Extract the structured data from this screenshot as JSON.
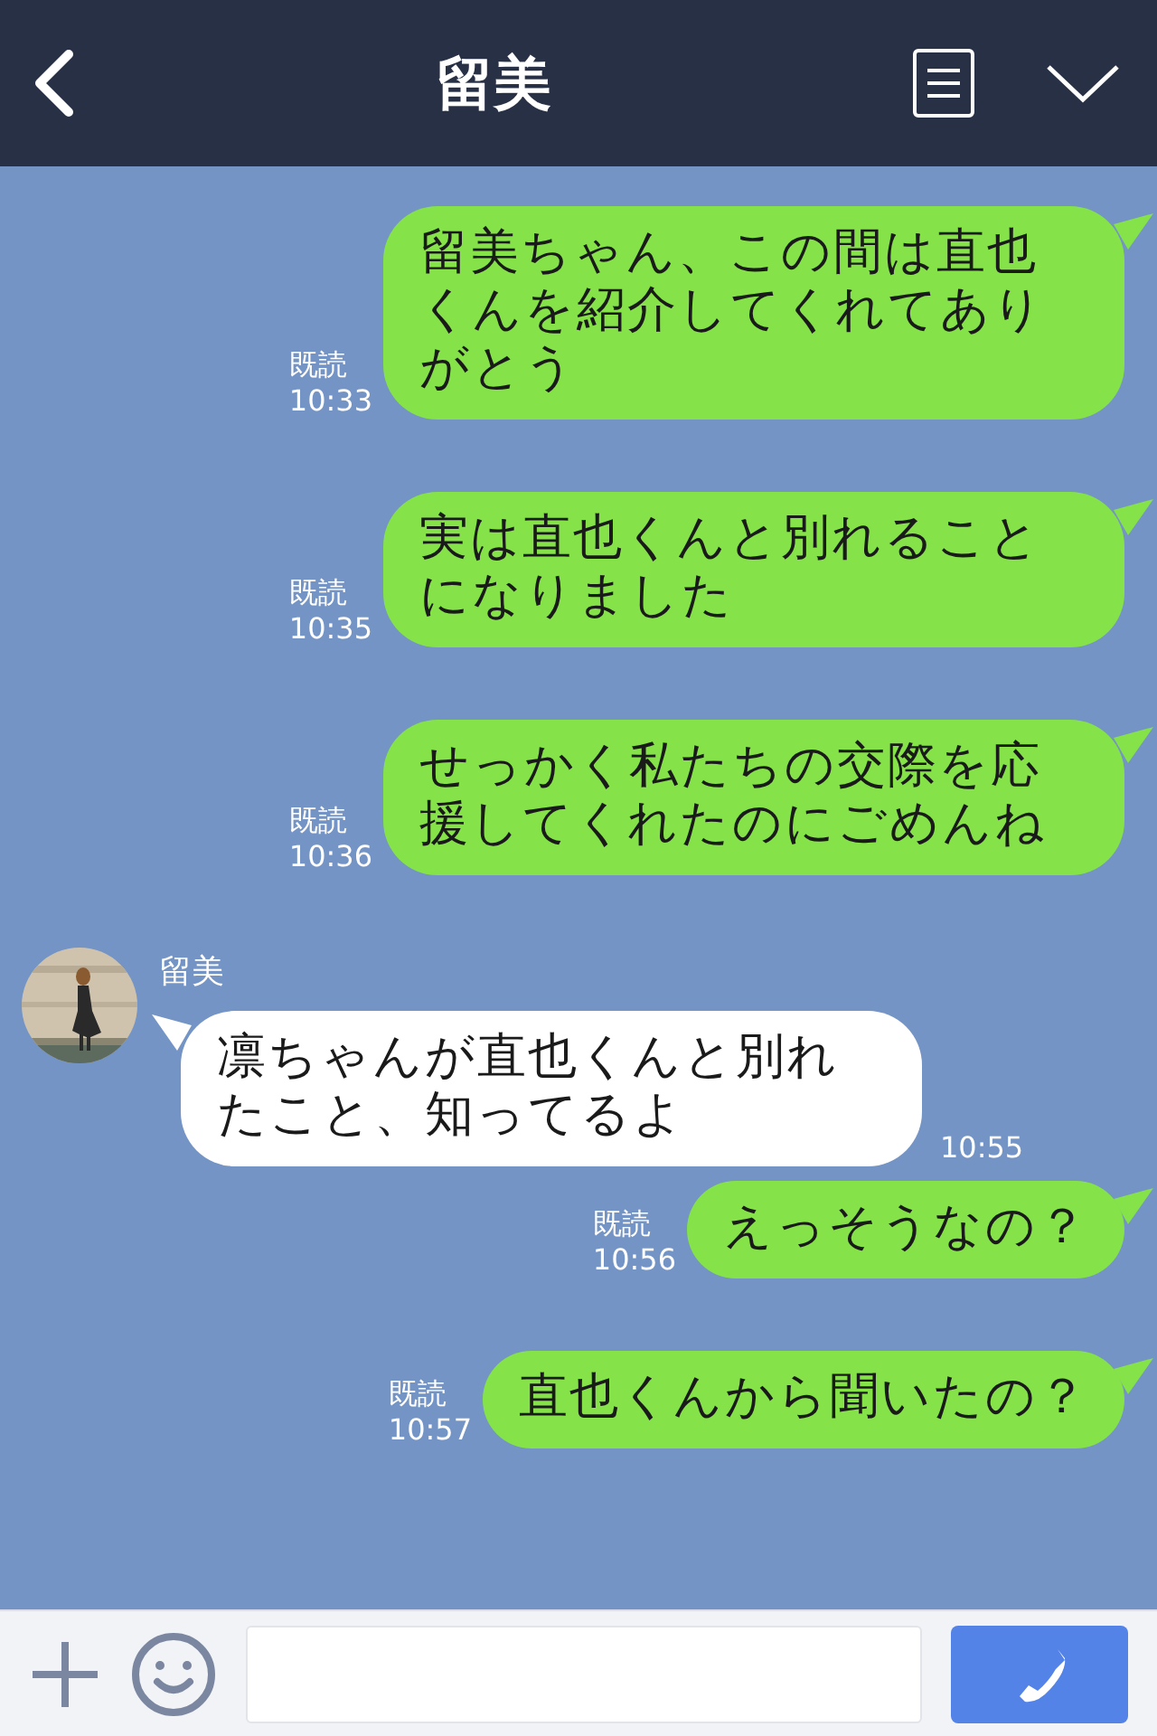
{
  "header": {
    "title": "留美"
  },
  "messages": [
    {
      "kind": "sent",
      "text": "留美ちゃん、この間は直也くんを紹介してくれてありがとう",
      "read": "既読",
      "time": "10:33"
    },
    {
      "kind": "sent",
      "text": "実は直也くんと別れることになりました",
      "read": "既読",
      "time": "10:35"
    },
    {
      "kind": "sent",
      "text": "せっかく私たちの交際を応援してくれたのにごめんね",
      "read": "既読",
      "time": "10:36"
    },
    {
      "kind": "received",
      "sender": "留美",
      "text": "凛ちゃんが直也くんと別れたこと、知ってるよ",
      "time": "10:55"
    },
    {
      "kind": "sent",
      "text": "えっそうなの？",
      "read": "既読",
      "time": "10:56"
    },
    {
      "kind": "sent",
      "text": "直也くんから聞いたの？",
      "read": "既読",
      "time": "10:57"
    }
  ]
}
